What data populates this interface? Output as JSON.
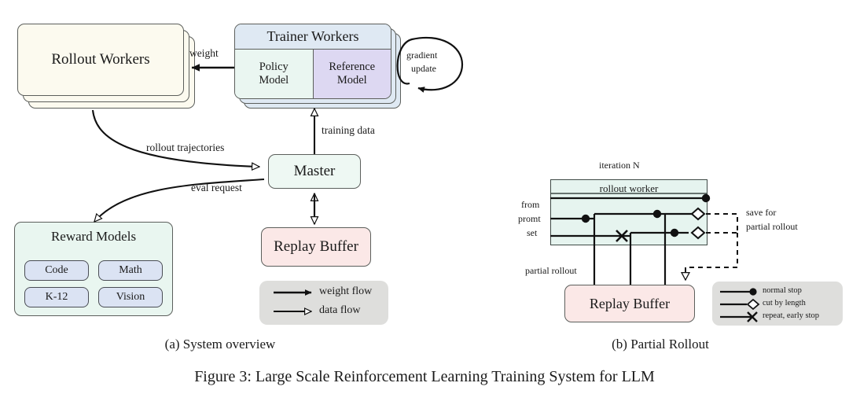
{
  "figure": {
    "caption": "Figure 3: Large Scale Reinforcement Learning Training System for LLM",
    "panel_a_caption": "(a) System overview",
    "panel_b_caption": "(b) Partial Rollout"
  },
  "panel_a": {
    "nodes": {
      "rollout_workers": "Rollout Workers",
      "trainer_workers": "Trainer Workers",
      "policy_model": "Policy\nModel",
      "policy_model_line1": "Policy",
      "policy_model_line2": "Model",
      "reference_model_line1": "Reference",
      "reference_model_line2": "Model",
      "master": "Master",
      "replay_buffer": "Replay Buffer",
      "reward_models": "Reward Models"
    },
    "reward_sub_models": [
      "Code",
      "Math",
      "K-12",
      "Vision"
    ],
    "edge_labels": {
      "weight": "weight",
      "gradient_update_line1": "gradient",
      "gradient_update_line2": "update",
      "rollout_trajectories": "rollout trajectories",
      "eval_request": "eval request",
      "training_data": "training data"
    },
    "legend": {
      "weight_flow": "weight flow",
      "data_flow": "data flow"
    }
  },
  "panel_b": {
    "iteration_label": "iteration N",
    "worker_label": "rollout worker",
    "source_label_line1": "from",
    "source_label_line2": "promt",
    "source_label_line3": "set",
    "save_label_line1": "save for",
    "save_label_line2": "partial rollout",
    "partial_rollout_label": "partial rollout",
    "replay_buffer": "Replay Buffer",
    "legend": [
      {
        "marker": "normal-stop-marker",
        "label": "normal stop"
      },
      {
        "marker": "cut-by-length-marker",
        "label": "cut by length"
      },
      {
        "marker": "repeat-early-stop-marker",
        "label": "repeat, early stop"
      }
    ]
  },
  "colors": {
    "rollout_workers_fill": "#fcfaef",
    "trainer_header_fill": "#dfe9f3",
    "policy_model_fill": "#eaf6f1",
    "reference_model_fill": "#ddd8f2",
    "master_fill": "#eef8f3",
    "replay_buffer_fill": "#fbe8e7",
    "reward_models_fill": "#e9f6f0",
    "reward_sub_fill": "#dbe3f3",
    "rollout_worker_panel_fill": "#e6f4ef",
    "legend_fill": "#dededc",
    "stroke": "#3f4a46"
  }
}
